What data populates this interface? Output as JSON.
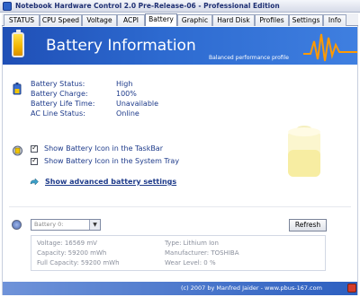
{
  "window": {
    "title": "Notebook Hardware Control 2.0 Pre-Release-06  -  Professional Edition"
  },
  "tabs": [
    {
      "label": "STATUS"
    },
    {
      "label": "CPU Speed"
    },
    {
      "label": "Voltage"
    },
    {
      "label": "ACPI"
    },
    {
      "label": "Battery",
      "active": true
    },
    {
      "label": "Graphic"
    },
    {
      "label": "Hard Disk"
    },
    {
      "label": "Profiles"
    },
    {
      "label": "Settings"
    },
    {
      "label": "Info"
    }
  ],
  "header": {
    "title": "Battery Information",
    "profile": "Balanced performance profile"
  },
  "status": {
    "battery_status_label": "Battery Status:",
    "battery_status_value": "High",
    "battery_charge_label": "Battery Charge:",
    "battery_charge_value": "100%",
    "battery_life_label": "Battery Life Time:",
    "battery_life_value": "Unavailable",
    "ac_line_label": "AC Line Status:",
    "ac_line_value": "Online"
  },
  "options": {
    "show_taskbar_label": "Show Battery Icon in the TaskBar",
    "show_taskbar_checked": true,
    "show_tray_label": "Show Battery Icon in the System Tray",
    "show_tray_checked": true,
    "advanced_link": "Show advanced battery settings"
  },
  "battery_select": {
    "value": "Battery 0:",
    "refresh_label": "Refresh"
  },
  "details": {
    "voltage": "Voltage: 16569 mV",
    "capacity": "Capacity: 59200 mWh",
    "full_capacity": "Full Capacity: 59200 mWh",
    "type": "Type: Lithium Ion",
    "manufacturer": "Manufacturer: TOSHIBA",
    "wear_level": "Wear Level: 0 %"
  },
  "footer": {
    "text": "(c) 2007 by Manfred Jaider - www.pbus-167.com"
  },
  "colors": {
    "header_blue": "#2d6ad0",
    "wave_orange": "#ff9a00",
    "text_blue": "#1d3a8a"
  }
}
